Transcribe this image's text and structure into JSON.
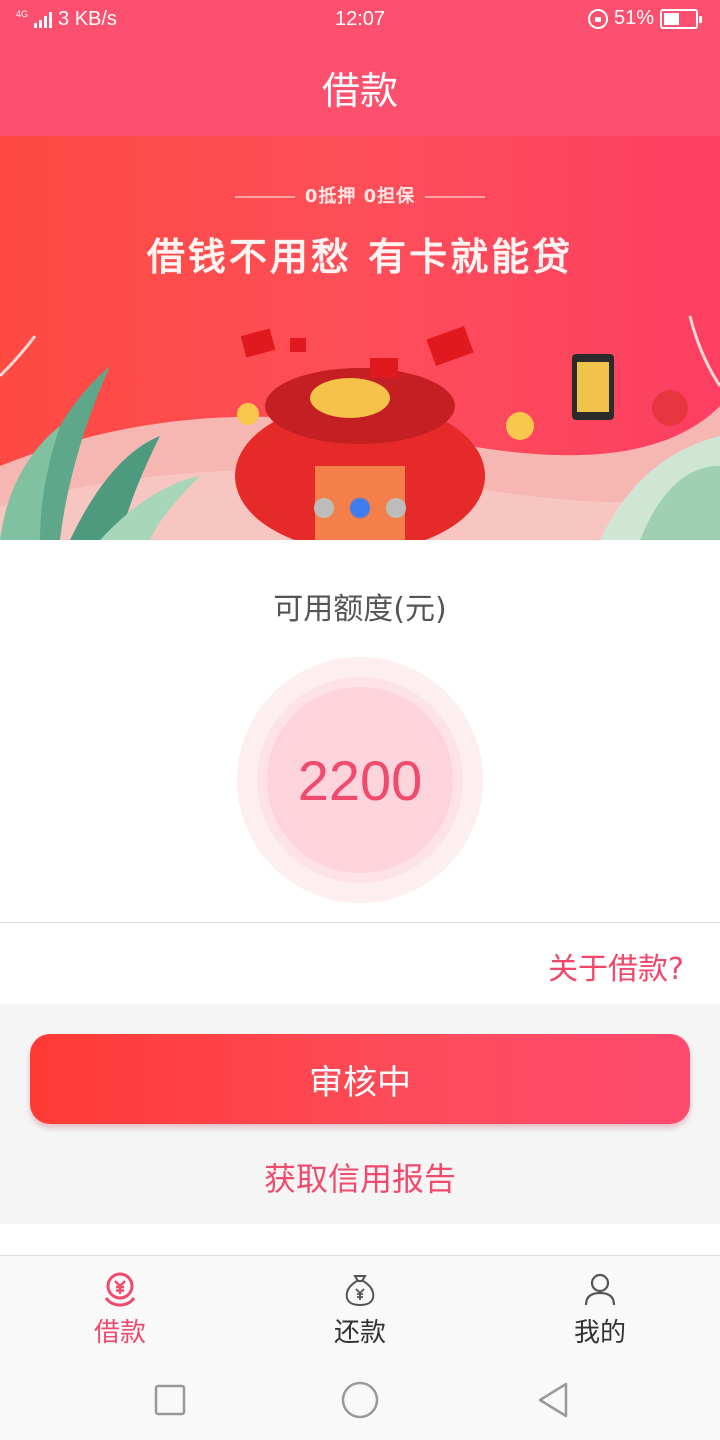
{
  "status_bar": {
    "network": "4G",
    "speed": "3 KB/s",
    "time": "12:07",
    "battery": "51%",
    "battery_level": 0.51
  },
  "header": {
    "title": "借款"
  },
  "banner": {
    "subtitle": "0抵押  0担保",
    "headline": "借钱不用愁 有卡就能贷",
    "slide_count": 3,
    "active_slide": 2
  },
  "credit": {
    "label": "可用额度(元)",
    "amount": "2200"
  },
  "about_link": "关于借款?",
  "primary_button": {
    "label": "审核中"
  },
  "report_link": "获取信用报告",
  "tabs": [
    {
      "label": "借款",
      "icon": "loan-icon",
      "active": true
    },
    {
      "label": "还款",
      "icon": "money-bag-icon",
      "active": false
    },
    {
      "label": "我的",
      "icon": "user-icon",
      "active": false
    }
  ],
  "colors": {
    "brand": "#fd4f6e",
    "accent_text": "#f04a6c",
    "active_dot": "#3c7df0"
  }
}
